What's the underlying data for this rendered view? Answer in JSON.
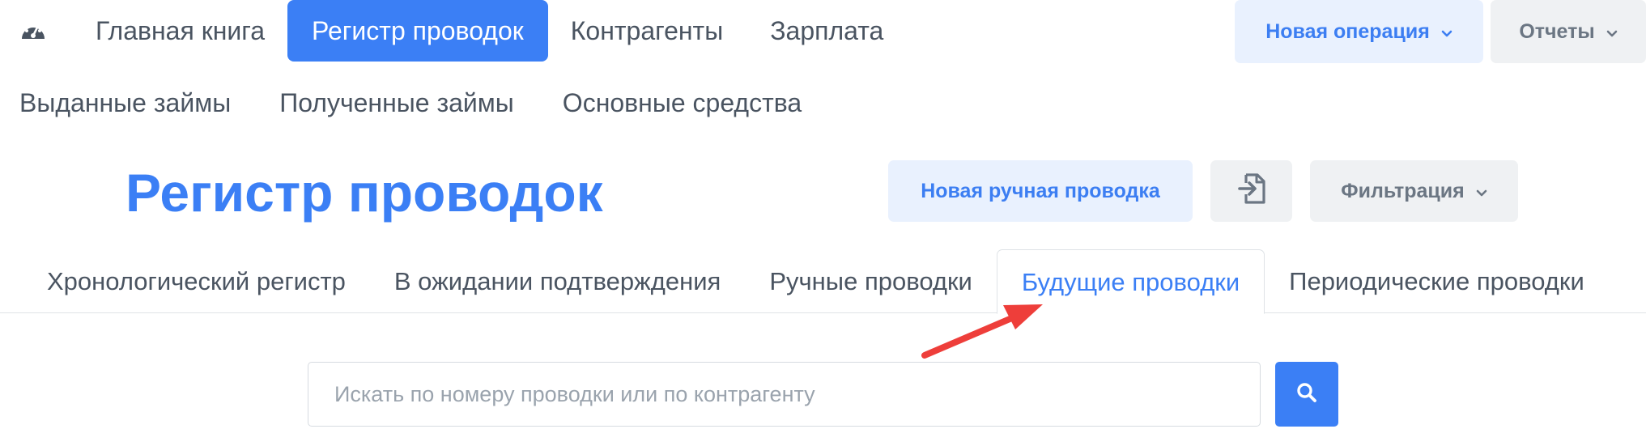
{
  "nav": {
    "primary": [
      {
        "label": "Главная книга",
        "active": false
      },
      {
        "label": "Регистр проводок",
        "active": true
      },
      {
        "label": "Контрагенты",
        "active": false
      },
      {
        "label": "Зарплата",
        "active": false
      }
    ],
    "secondary": [
      {
        "label": "Выданные займы"
      },
      {
        "label": "Полученные займы"
      },
      {
        "label": "Основные средства"
      }
    ],
    "dashboard_icon": "dashboard-gauge-icon"
  },
  "top_actions": {
    "new_operation": "Новая операция",
    "reports": "Отчеты",
    "chevron_icon": "chevron-down-icon"
  },
  "page": {
    "title": "Регистр проводок",
    "new_manual_entry": "Новая ручная проводка",
    "import_icon": "file-import-icon",
    "filter": "Фильтрация"
  },
  "tabs": [
    {
      "label": "Хронологический регистр",
      "active": false
    },
    {
      "label": "В ожидании подтверждения",
      "active": false
    },
    {
      "label": "Ручные проводки",
      "active": false
    },
    {
      "label": "Будущие проводки",
      "active": true
    },
    {
      "label": "Периодические проводки",
      "active": false
    }
  ],
  "search": {
    "placeholder": "Искать по номеру проводки или по контрагенту",
    "value": "",
    "button_icon": "search-icon"
  },
  "annotation": {
    "arrow_color": "#ee3e3a",
    "points_to": "Будущие проводки"
  },
  "colors": {
    "accent": "#3b7ff5",
    "accent_light_bg": "#e9f1fe",
    "grey_bg": "#eff1f3",
    "text": "#4a5461"
  }
}
